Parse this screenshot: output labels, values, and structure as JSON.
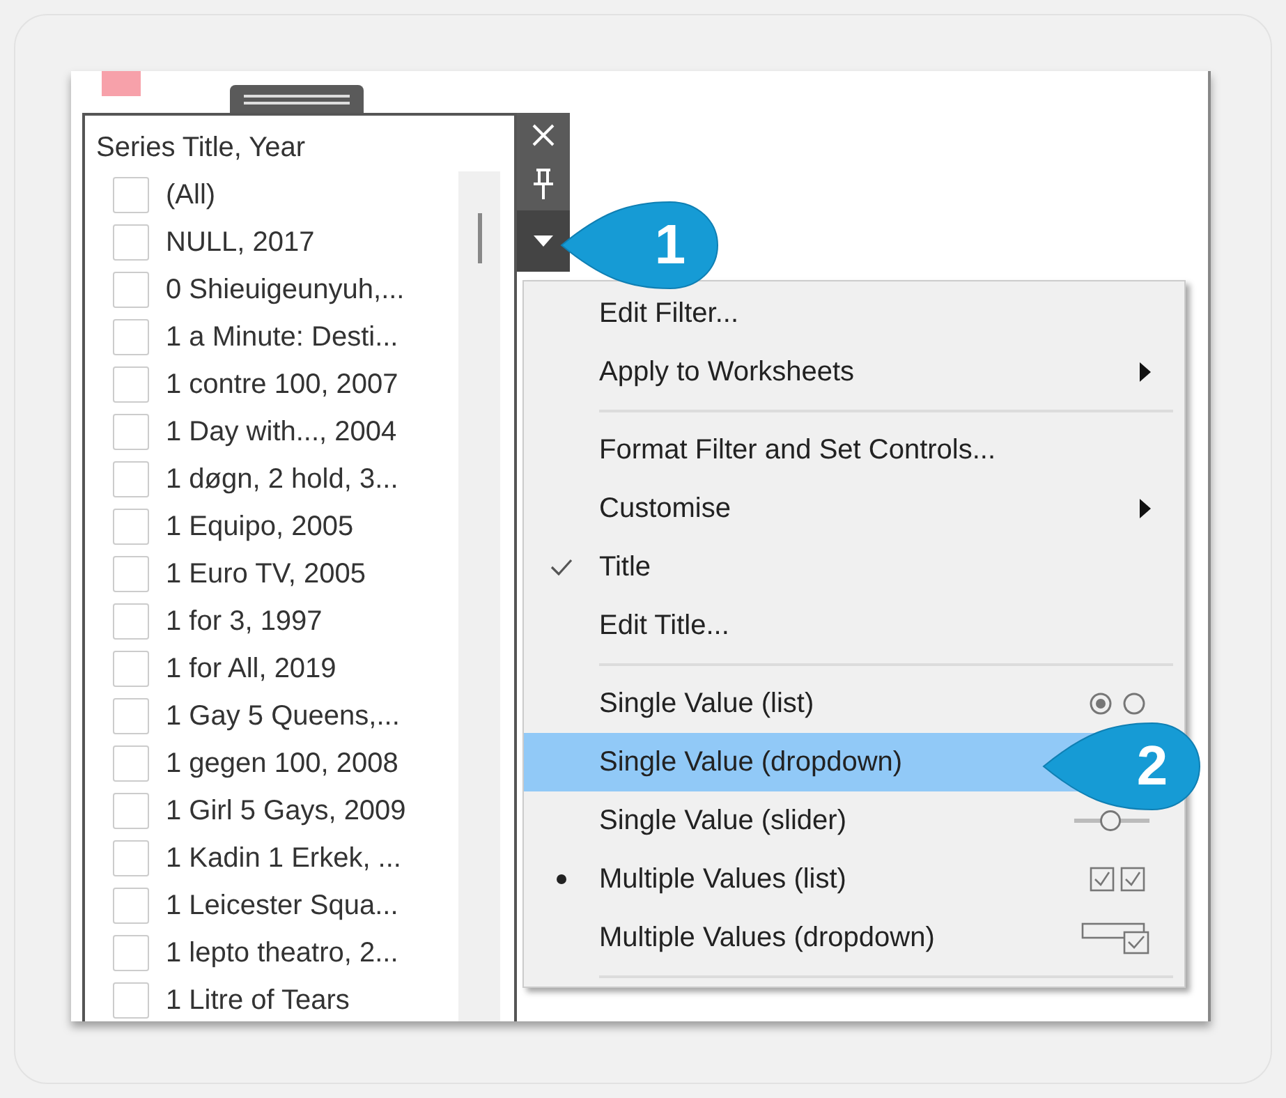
{
  "filter_card": {
    "title": "Series Title, Year",
    "items": [
      {
        "label": "(All)",
        "checked": false
      },
      {
        "label": "NULL, 2017",
        "checked": false
      },
      {
        "label": "0 Shieuigeunyuh,...",
        "checked": false
      },
      {
        "label": "1 a Minute: Desti...",
        "checked": false
      },
      {
        "label": "1 contre 100, 2007",
        "checked": false
      },
      {
        "label": "1 Day with..., 2004",
        "checked": false
      },
      {
        "label": "1 døgn, 2 hold, 3...",
        "checked": false
      },
      {
        "label": "1 Equipo, 2005",
        "checked": false
      },
      {
        "label": "1 Euro TV, 2005",
        "checked": false
      },
      {
        "label": "1 for 3, 1997",
        "checked": false
      },
      {
        "label": "1 for All, 2019",
        "checked": false
      },
      {
        "label": "1 Gay 5 Queens,...",
        "checked": false
      },
      {
        "label": "1 gegen 100, 2008",
        "checked": false
      },
      {
        "label": "1 Girl 5 Gays, 2009",
        "checked": false
      },
      {
        "label": "1 Kadin 1 Erkek, ...",
        "checked": false
      },
      {
        "label": "1 Leicester Squa...",
        "checked": false
      },
      {
        "label": "1 lepto theatro, 2...",
        "checked": false
      },
      {
        "label": "1 Litre of Tears",
        "checked": false
      }
    ]
  },
  "context_menu": {
    "items": [
      {
        "kind": "command",
        "label": "Edit Filter...",
        "selected": false
      },
      {
        "kind": "submenu",
        "label": "Apply to Worksheets",
        "selected": false
      },
      {
        "kind": "separator"
      },
      {
        "kind": "command",
        "label": "Format Filter and Set Controls...",
        "selected": false
      },
      {
        "kind": "submenu",
        "label": "Customise",
        "selected": false
      },
      {
        "kind": "toggle",
        "label": "Title",
        "checked": true,
        "selected": false
      },
      {
        "kind": "command",
        "label": "Edit Title...",
        "selected": false
      },
      {
        "kind": "separator"
      },
      {
        "kind": "mode",
        "label": "Single Value (list)",
        "checked": false,
        "selected": false
      },
      {
        "kind": "mode",
        "label": "Single Value (dropdown)",
        "checked": false,
        "selected": true
      },
      {
        "kind": "mode",
        "label": "Single Value (slider)",
        "checked": false,
        "selected": false
      },
      {
        "kind": "mode",
        "label": "Multiple Values (list)",
        "checked": true,
        "selected": false
      },
      {
        "kind": "mode",
        "label": "Multiple Values (dropdown)",
        "checked": false,
        "selected": false
      },
      {
        "kind": "separator"
      }
    ]
  },
  "callouts": [
    {
      "label": "1"
    },
    {
      "label": "2"
    }
  ]
}
